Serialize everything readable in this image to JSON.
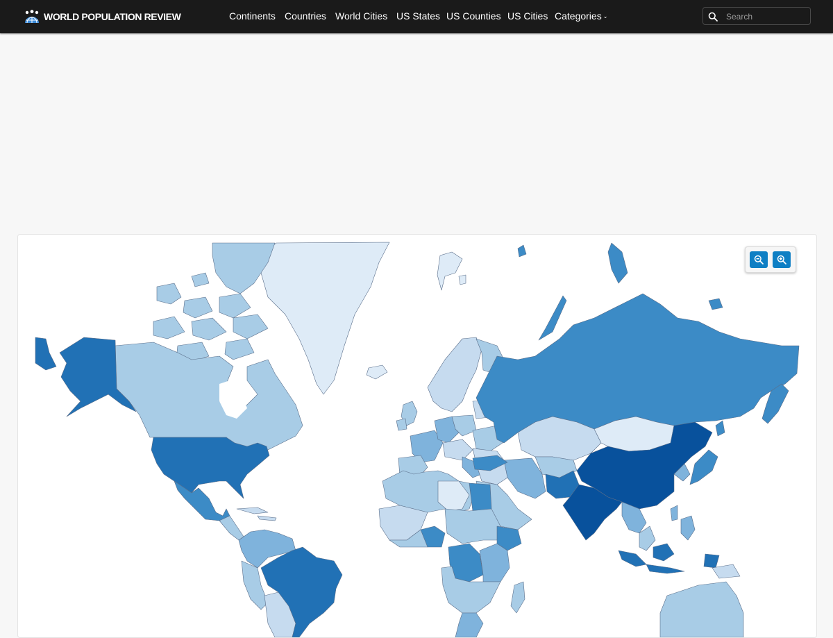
{
  "brand": {
    "name": "WORLD POPULATION REVIEW",
    "logo_icon": "people-globe-icon"
  },
  "nav": {
    "items": [
      {
        "label": "Continents"
      },
      {
        "label": "Countries"
      },
      {
        "label": "World Cities"
      },
      {
        "label": "US States"
      },
      {
        "label": "US Counties"
      },
      {
        "label": "US Cities"
      },
      {
        "label": "Categories",
        "has_dropdown": true
      }
    ]
  },
  "search": {
    "placeholder": "Search",
    "icon": "search-icon"
  },
  "map": {
    "type": "choropleth",
    "controls": {
      "zoom_out_icon": "zoom-out-icon",
      "zoom_in_icon": "zoom-in-icon"
    },
    "colors": {
      "lightest": "#deebf7",
      "light": "#c6dbef",
      "medium_light": "#a8cce6",
      "medium": "#7fb3dc",
      "medium_dark": "#3c8bc6",
      "dark": "#2171b5",
      "darkest": "#08519c",
      "border": "#5a6e8a"
    }
  }
}
